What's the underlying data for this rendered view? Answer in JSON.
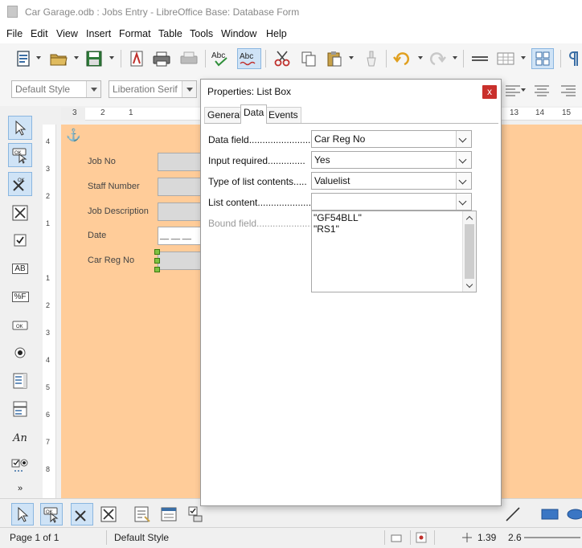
{
  "window": {
    "title": "Car Garage.odb : Jobs Entry - LibreOffice Base: Database Form"
  },
  "menu": [
    "File",
    "Edit",
    "View",
    "Insert",
    "Format",
    "Table",
    "Tools",
    "Window",
    "Help"
  ],
  "formatting": {
    "paragraph_style": "Default Style",
    "font_name": "Liberation Serif"
  },
  "ruler": {
    "top_left": [
      "3",
      "2",
      "1"
    ],
    "top_right": [
      "13",
      "14",
      "15"
    ],
    "left": [
      "4",
      "3",
      "2",
      "1",
      "1",
      "2",
      "3",
      "4",
      "5",
      "6",
      "7",
      "8"
    ]
  },
  "form": {
    "labels": [
      "Job No",
      "Staff Number",
      "Job Description",
      "Date",
      "Car Reg No"
    ],
    "date_placeholder": "__ __ __"
  },
  "left_toolbar": {
    "text_box_label": "AB",
    "formatted_label": "%F",
    "label_field": "An",
    "more": "»"
  },
  "dialog": {
    "title": "Properties: List Box",
    "close": "x",
    "tabs": [
      "General",
      "Data",
      "Events"
    ],
    "active_tab": "Data",
    "rows": [
      {
        "label": "Data field.........................",
        "value": "Car Reg No"
      },
      {
        "label": "Input required..............",
        "value": "Yes"
      },
      {
        "label": "Type of list contents.....",
        "value": "Valuelist"
      },
      {
        "label": "List content....................",
        "value": ""
      }
    ],
    "bound_field_label": "Bound field.....................",
    "list_items": [
      "\"GF54BLL\"",
      "\"RS1\""
    ]
  },
  "status": {
    "page": "Page 1 of 1",
    "style": "Default Style",
    "position": "1.39",
    "size": "2.6"
  },
  "colors": {
    "form_background": "#ffcc99",
    "close_button": "#c9302c",
    "active_tool": "#cfe3f6"
  }
}
